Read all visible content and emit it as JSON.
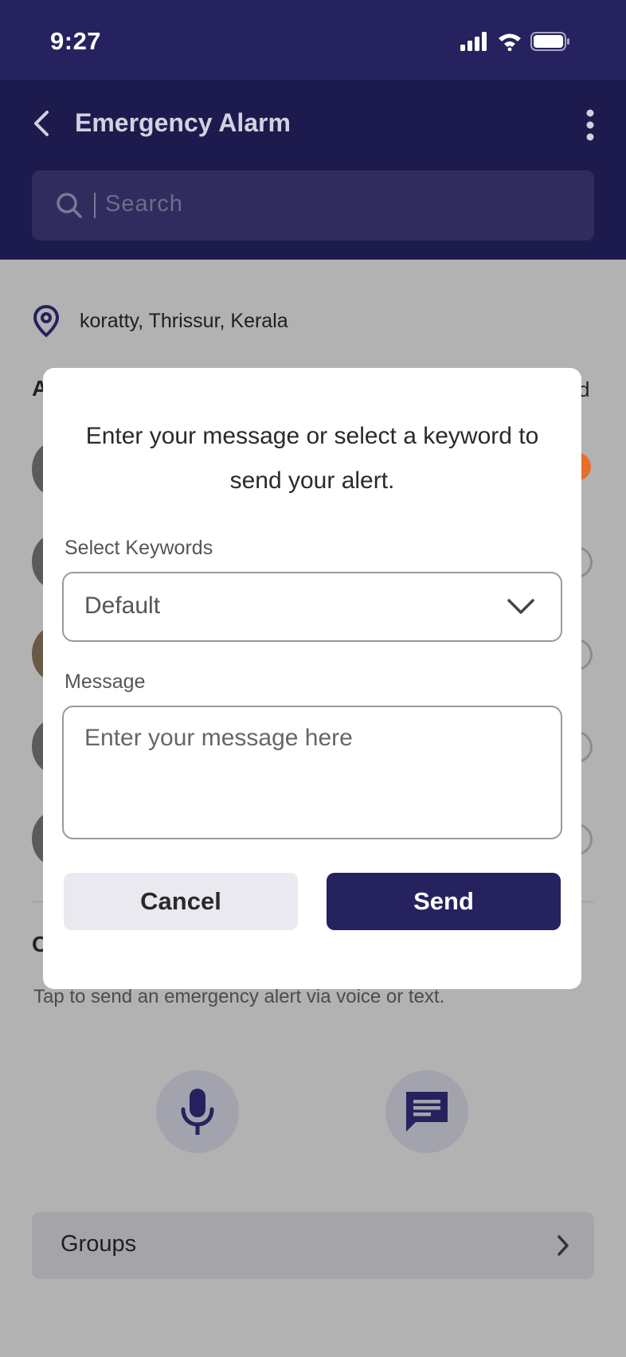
{
  "status_bar": {
    "time": "9:27"
  },
  "header": {
    "title": "Emergency Alarm"
  },
  "search": {
    "placeholder": "Search"
  },
  "location": {
    "text": "koratty, Thrissur, Kerala"
  },
  "background": {
    "peek_left_letter": "A",
    "peek_right_letter": "d",
    "peek_section_letter": "C",
    "hint": "Tap to send an emergency alert via voice or text."
  },
  "groups": {
    "label": "Groups"
  },
  "modal": {
    "title": "Enter your message or select a keyword to send your alert.",
    "keywords_label": "Select Keywords",
    "keywords_value": "Default",
    "message_label": "Message",
    "message_placeholder": "Enter your message here",
    "cancel_label": "Cancel",
    "send_label": "Send"
  },
  "colors": {
    "header_bg": "#1d1a4d",
    "primary": "#26225f",
    "overlay": "#b2b2b2",
    "accent_orange": "#e6702a"
  }
}
